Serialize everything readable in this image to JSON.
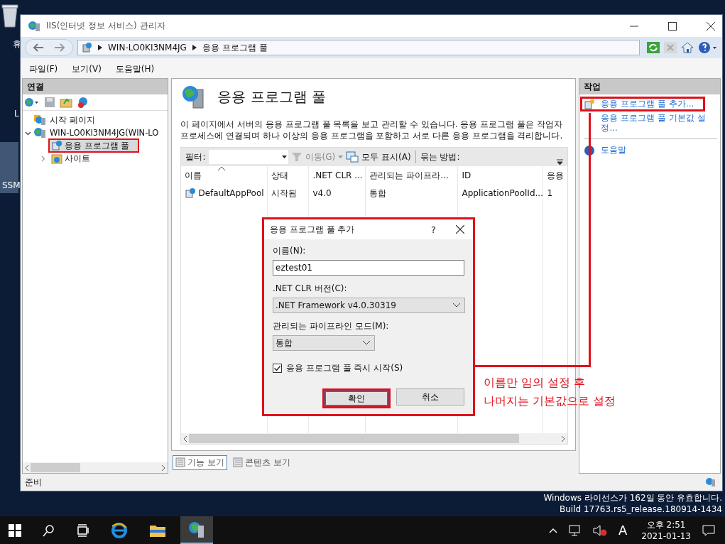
{
  "desktop": {
    "icons": [
      {
        "label": "휴"
      },
      {
        "label": "L"
      },
      {
        "label": "SSM"
      }
    ],
    "notice": [
      "Windows 라이선스가 162일 동안 유효합니다.",
      "Build 17763.rs5_release.180914-1434"
    ]
  },
  "window": {
    "title": "IIS(인터넷 정보 서비스) 관리자"
  },
  "address": {
    "crumbs": [
      "WIN-LO0KI3NM4JG",
      "응용 프로그램 풀"
    ]
  },
  "menu": [
    "파일(F)",
    "보기(V)",
    "도움말(H)"
  ],
  "connections": {
    "title": "연결",
    "tree": [
      {
        "label": "시작 페이지",
        "kind": "start",
        "selected": false
      },
      {
        "label": "WIN-LO0KI3NM4JG(WIN-LO",
        "kind": "server",
        "selected": false,
        "expanded": true,
        "children": [
          {
            "label": "응용 프로그램 풀",
            "kind": "pools",
            "selected": true
          },
          {
            "label": "사이트",
            "kind": "sites",
            "selected": false,
            "expanded": false
          }
        ]
      }
    ]
  },
  "content": {
    "heading": "응용 프로그램 풀",
    "description": "이 페이지에서 서버의 응용 프로그램 풀 목록을 보고 관리할 수 있습니다. 응용 프로그램 풀은 작업자 프로세스에 연결되며 하나 이상의 응용 프로그램을 포함하고 서로 다른 응용 프로그램을 격리합니다.",
    "filter": {
      "label": "필터:",
      "go": "이동(G)",
      "show_all": "모두 표시(A)",
      "group_by": "묶는 방법:"
    },
    "table": {
      "columns": [
        "이름",
        "상태",
        ".NET CLR ...",
        "관리되는 파이프라...",
        "ID",
        "응용"
      ],
      "rows": [
        [
          "DefaultAppPool",
          "시작됨",
          "v4.0",
          "통합",
          "ApplicationPoolId...",
          "1"
        ]
      ]
    },
    "views": [
      {
        "label": "기능 보기",
        "selected": true
      },
      {
        "label": "콘텐츠 보기",
        "selected": false
      }
    ]
  },
  "actions": {
    "title": "작업",
    "items": [
      {
        "label": "응용 프로그램 풀 추가...",
        "kind": "add"
      },
      {
        "label": "응용 프로그램 풀 기본값 설정...",
        "kind": "plain"
      },
      {
        "label": "도움말",
        "kind": "help"
      }
    ]
  },
  "status_bar": {
    "text": "준비"
  },
  "dialog": {
    "title": "응용 프로그램 풀 추가",
    "help": "?",
    "name_label": "이름(N):",
    "name_value": "eztest01",
    "clr_label": ".NET CLR 버전(C):",
    "clr_value": ".NET Framework v4.0.30319",
    "pipeline_label": "관리되는 파이프라인 모드(M):",
    "pipeline_value": "통합",
    "start_now": {
      "label": "응용 프로그램 풀 즉시 시작(S)",
      "checked": true
    },
    "buttons": [
      "확인",
      "취소"
    ]
  },
  "annotation": {
    "lines": [
      "이름만 임의 설정 후",
      "나머지는 기본값으로 설정"
    ]
  },
  "taskbar": {
    "ime": "A",
    "time": "오후 2:51",
    "date": "2021-01-13"
  }
}
